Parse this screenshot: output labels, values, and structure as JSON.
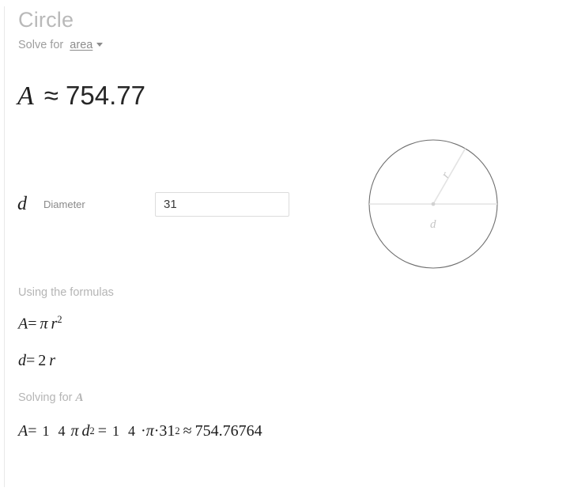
{
  "header": {
    "title": "Circle",
    "solve_prefix": "Solve for",
    "solve_value": "area",
    "caret_icon": "chevron-down-icon"
  },
  "result": {
    "symbol": "A",
    "value": "≈ 754.77"
  },
  "input_row": {
    "symbol": "d",
    "label": "Diameter",
    "value": "31",
    "placeholder": ""
  },
  "diagram": {
    "shape": "circle",
    "radius_label": "r",
    "diameter_label": "d",
    "circle_stroke": "#6e6e6e",
    "line_color": "#e3e3e3",
    "label_color": "#c6c6c6"
  },
  "formulas": {
    "section_label": "Using the formulas",
    "area": {
      "lhs": "A",
      "eq": "=",
      "pi": "π",
      "r": "r",
      "exp": "2"
    },
    "diameter": {
      "lhs": "d",
      "eq": "=",
      "two": "2",
      "r": "r"
    }
  },
  "solving": {
    "section_label_prefix": "Solving for",
    "section_label_symbol": "A",
    "lhs": "A",
    "eq1": "=",
    "frac1_num": "1",
    "frac1_den": "4",
    "pi1": "π",
    "d": "d",
    "d_exp": "2",
    "eq2": "=",
    "frac2_num": "1",
    "frac2_den": "4",
    "dot1": "·",
    "pi2": "π",
    "dot2": "·",
    "base": "31",
    "base_exp": "2",
    "approx": "≈",
    "result": "754.76764"
  }
}
